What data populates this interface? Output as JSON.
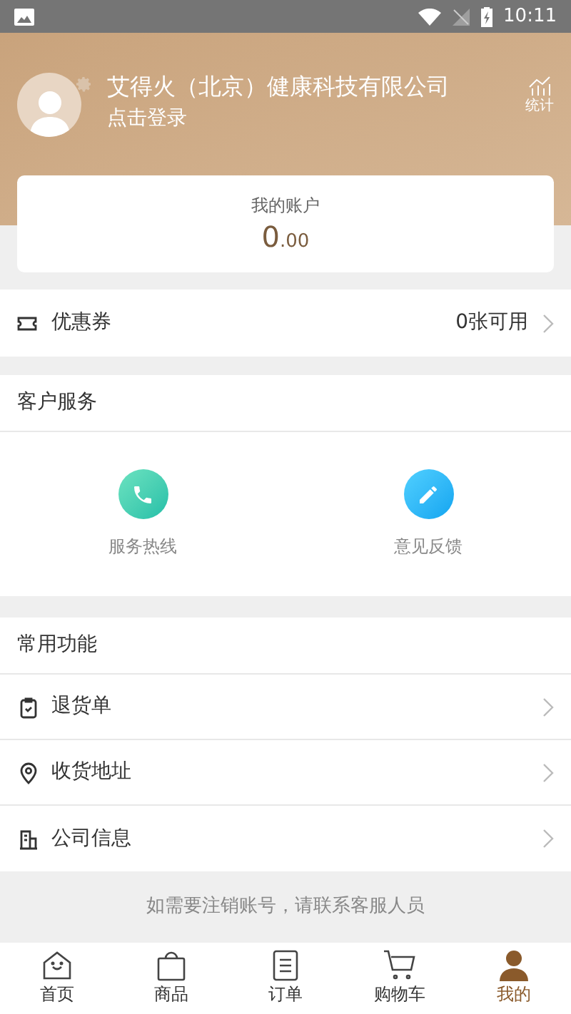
{
  "status_bar": {
    "time": "10:11"
  },
  "profile": {
    "company": "艾得火（北京）健康科技有限公司",
    "login": "点击登录",
    "stats_label": "统计"
  },
  "account": {
    "title": "我的账户",
    "amount_integer": "0",
    "amount_decimal": ".00"
  },
  "coupon": {
    "label": "优惠券",
    "value": "0张可用"
  },
  "customer_service": {
    "title": "客户服务",
    "items": [
      {
        "kind": "phone",
        "label": "服务热线"
      },
      {
        "kind": "edit",
        "label": "意见反馈"
      }
    ]
  },
  "common_functions": {
    "title": "常用功能",
    "items": [
      {
        "kind": "return",
        "label": "退货单"
      },
      {
        "kind": "location",
        "label": "收货地址"
      },
      {
        "kind": "company",
        "label": "公司信息"
      }
    ]
  },
  "notice": "如需要注销账号，请联系客服人员",
  "tab_bar": [
    {
      "kind": "home",
      "label": "首页",
      "selected": false
    },
    {
      "kind": "bag",
      "label": "商品",
      "selected": false
    },
    {
      "kind": "order",
      "label": "订单",
      "selected": false
    },
    {
      "kind": "cart",
      "label": "购物车",
      "selected": false
    },
    {
      "kind": "me",
      "label": "我的",
      "selected": true
    }
  ]
}
